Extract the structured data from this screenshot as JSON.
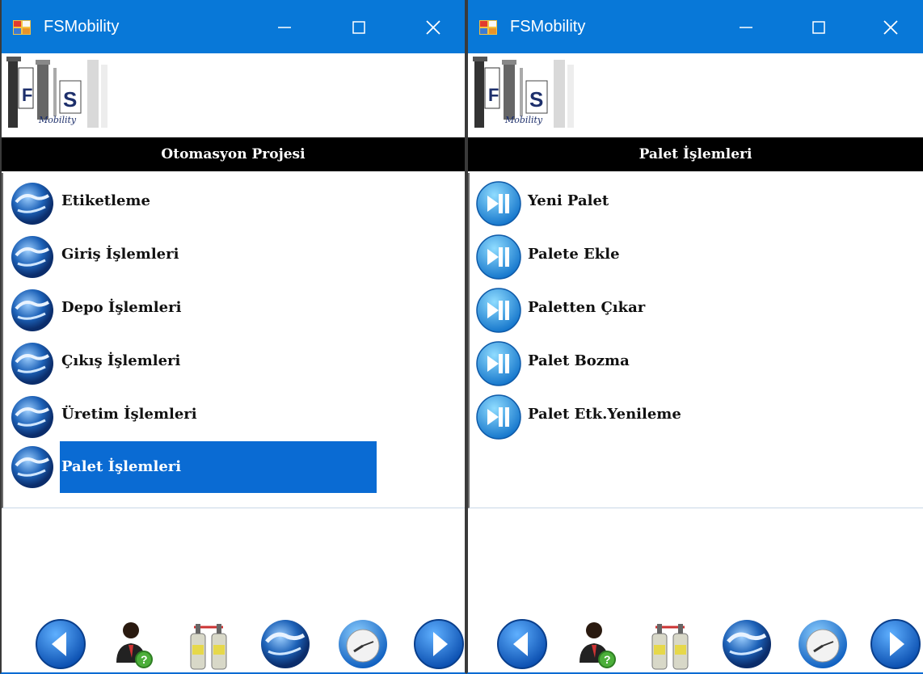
{
  "windows": [
    {
      "title": "FSMobility",
      "section_header": "Otomasyon Projesi",
      "item_icon": "globe-icon",
      "items": [
        {
          "label": "Etiketleme",
          "selected": false
        },
        {
          "label": "Giriş İşlemleri",
          "selected": false
        },
        {
          "label": "Depo İşlemleri",
          "selected": false
        },
        {
          "label": "Çıkış İşlemleri",
          "selected": false
        },
        {
          "label": "Üretim İşlemleri",
          "selected": false
        },
        {
          "label": "Palet İşlemleri",
          "selected": true
        }
      ]
    },
    {
      "title": "FSMobility",
      "section_header": "Palet İşlemleri",
      "item_icon": "skip-forward-icon",
      "items": [
        {
          "label": "Yeni Palet",
          "selected": false
        },
        {
          "label": "Palete Ekle",
          "selected": false
        },
        {
          "label": "Paletten Çıkar",
          "selected": false
        },
        {
          "label": "Palet Bozma",
          "selected": false
        },
        {
          "label": "Palet Etk.Yenileme",
          "selected": false
        }
      ]
    }
  ],
  "logo": {
    "letters": "F S",
    "subtitle": "Mobility"
  },
  "toolbar_icons": [
    "back-arrow-icon",
    "user-help-icon",
    "gas-cylinders-icon",
    "globe-icon",
    "clock-icon",
    "forward-arrow-icon"
  ],
  "colors": {
    "titlebar": "#0878d8",
    "selection": "#0a6bd3",
    "header_bg": "#000000"
  }
}
